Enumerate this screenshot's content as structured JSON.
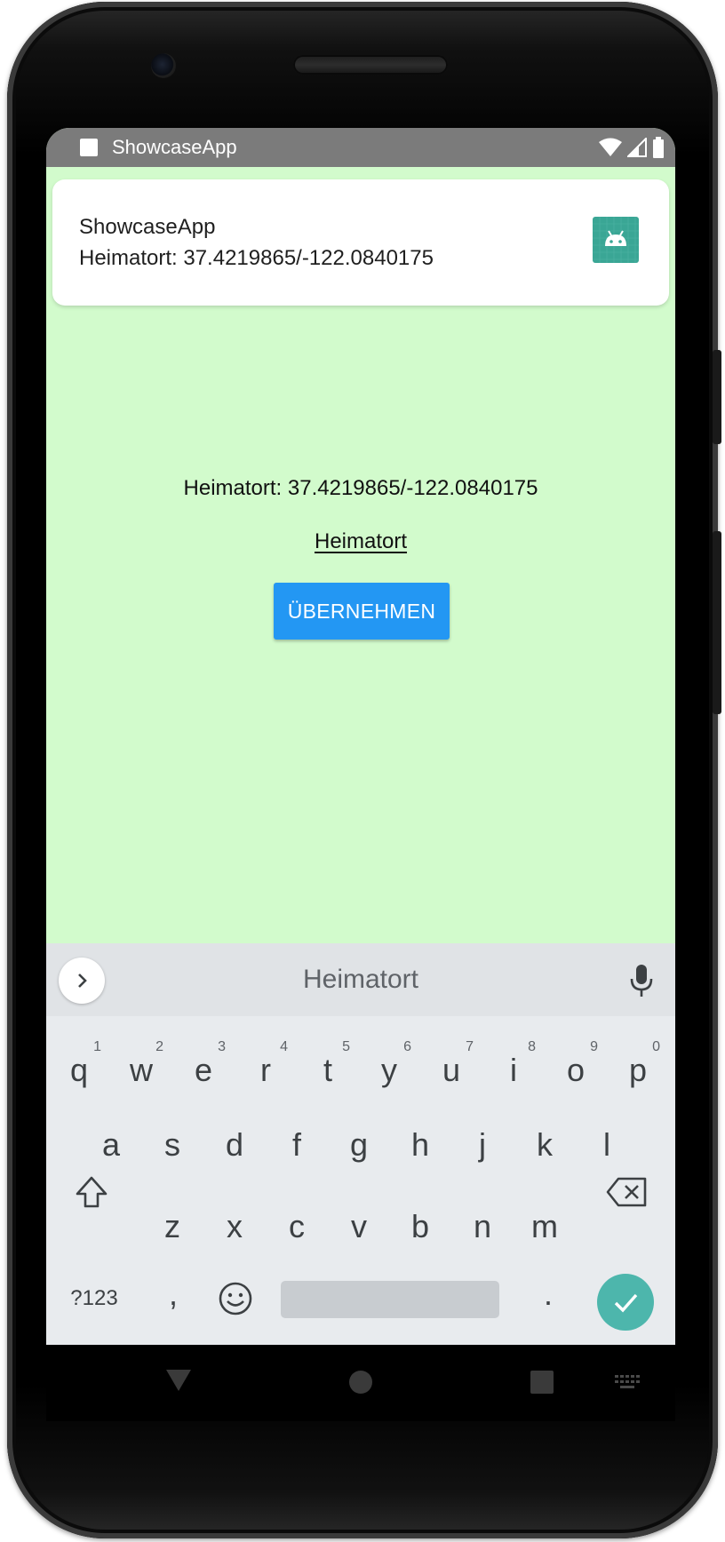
{
  "status_bar": {
    "app_name": "ShowcaseApp"
  },
  "notification": {
    "title": "ShowcaseApp",
    "text": "Heimatort: 37.4219865/-122.0840175"
  },
  "main": {
    "location_text": "Heimatort: 37.4219865/-122.0840175",
    "input_value": "Heimatort",
    "apply_button_label": "ÜBERNEHMEN"
  },
  "keyboard": {
    "suggestion": "Heimatort",
    "row1": [
      {
        "key": "q",
        "hint": "1"
      },
      {
        "key": "w",
        "hint": "2"
      },
      {
        "key": "e",
        "hint": "3"
      },
      {
        "key": "r",
        "hint": "4"
      },
      {
        "key": "t",
        "hint": "5"
      },
      {
        "key": "y",
        "hint": "6"
      },
      {
        "key": "u",
        "hint": "7"
      },
      {
        "key": "i",
        "hint": "8"
      },
      {
        "key": "o",
        "hint": "9"
      },
      {
        "key": "p",
        "hint": "0"
      }
    ],
    "row2": [
      "a",
      "s",
      "d",
      "f",
      "g",
      "h",
      "j",
      "k",
      "l"
    ],
    "row3": [
      "z",
      "x",
      "c",
      "v",
      "b",
      "n",
      "m"
    ],
    "symbols_label": "?123",
    "comma": ",",
    "period": "."
  },
  "colors": {
    "screen_bg": "#d2fbcc",
    "button": "#2397f3",
    "status_bar": "#7b7b7b",
    "enter_key": "#4db6ac"
  }
}
